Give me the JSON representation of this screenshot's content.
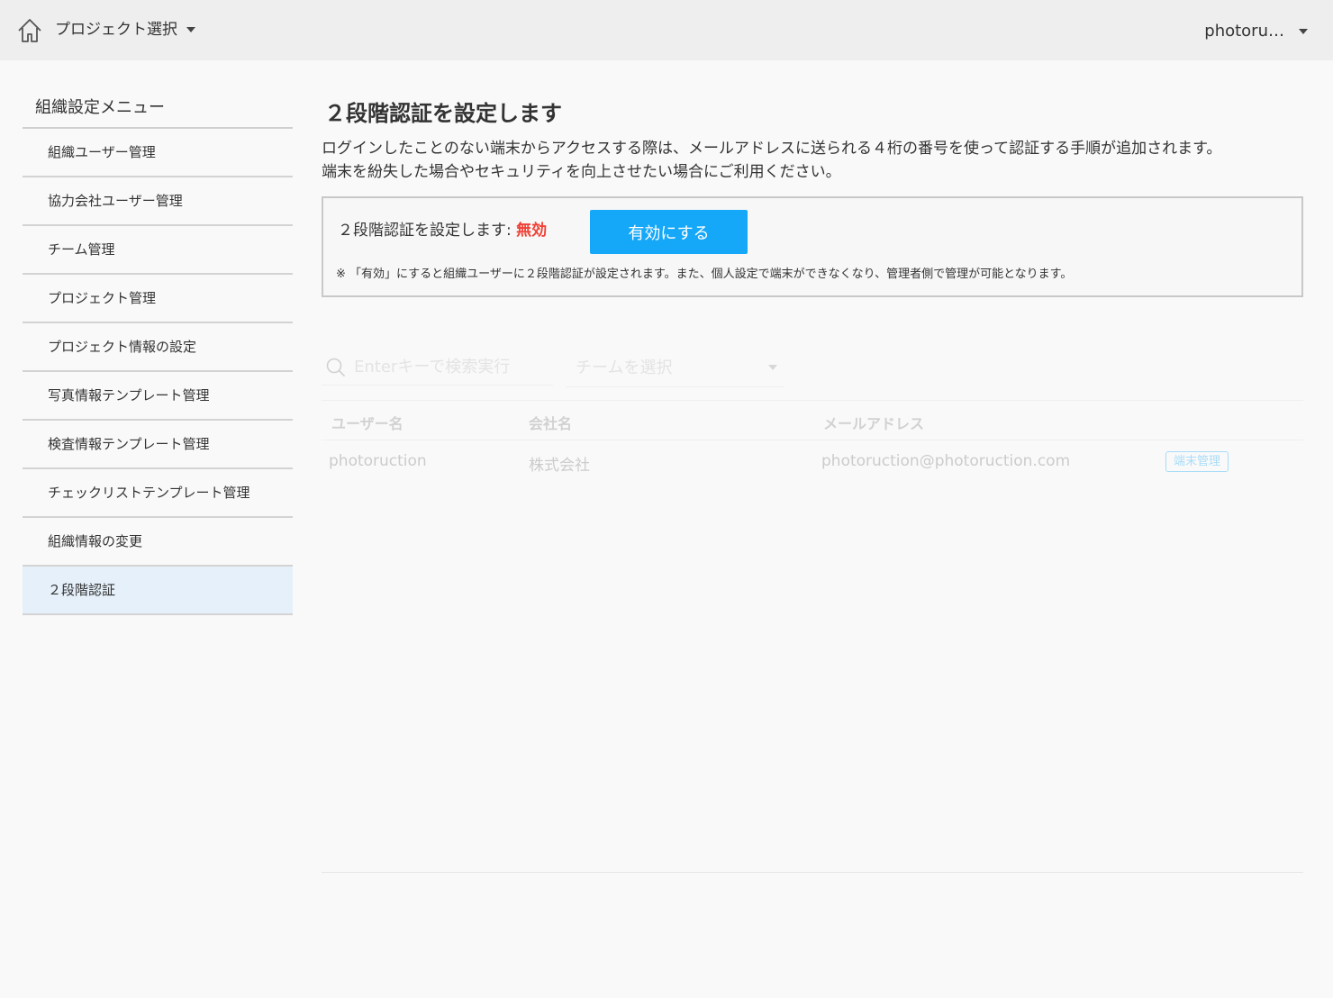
{
  "header": {
    "project_select": "プロジェクト選択",
    "user_name": "photoru…"
  },
  "sidebar": {
    "title": "組織設定メニュー",
    "items": [
      {
        "label": "組織ユーザー管理"
      },
      {
        "label": "協力会社ユーザー管理"
      },
      {
        "label": "チーム管理"
      },
      {
        "label": "プロジェクト管理"
      },
      {
        "label": "プロジェクト情報の設定"
      },
      {
        "label": "写真情報テンプレート管理"
      },
      {
        "label": "検査情報テンプレート管理"
      },
      {
        "label": "チェックリストテンプレート管理"
      },
      {
        "label": "組織情報の変更"
      },
      {
        "label": "２段階認証"
      }
    ]
  },
  "main": {
    "title": "２段階認証を設定します",
    "description_line1": "ログインしたことのない端末からアクセスする際は、メールアドレスに送られる４桁の番号を使って認証する手順が追加されます。",
    "description_line2": "端末を紛失した場合やセキュリティを向上させたい場合にご利用ください。",
    "setting_label": "２段階認証を設定します: ",
    "setting_status": "無効",
    "enable_button": "有効にする",
    "note": "※ 「有効」にすると組織ユーザーに２段階認証が設定されます。また、個人設定で端末ができなくなり、管理者側で管理が可能となります。"
  },
  "colors": {
    "accent": "#15a8f8",
    "status_disabled": "#f04035",
    "active_item_bg": "#e5f0fa"
  },
  "filters": {
    "search_placeholder": "Enterキーで検索実行",
    "team_select": "チームを選択"
  },
  "table": {
    "columns": [
      "ユーザー名",
      "会社名",
      "メールアドレス"
    ],
    "rows": [
      {
        "username": "photoruction",
        "company": "株式会社",
        "email": "photoruction@photoruction.com",
        "badge": "端末管理"
      }
    ]
  }
}
